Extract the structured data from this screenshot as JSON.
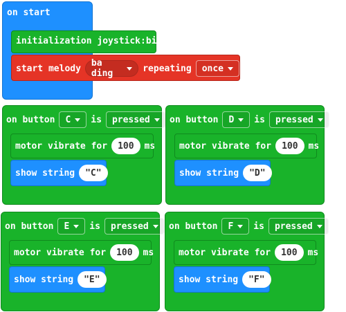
{
  "on_start": {
    "label": "on start",
    "init_label": "initialization joystick:bit",
    "melody": {
      "start_label": "start melody",
      "melody_value": "ba ding",
      "repeating_label": "repeating",
      "repeat_value": "once"
    }
  },
  "common": {
    "on_button_label": "on button",
    "is_label": "is",
    "pressed_label": "pressed",
    "motor_label": "motor vibrate for",
    "ms_label": "ms",
    "show_label": "show string",
    "quote_open": "\"",
    "quote_close": "\""
  },
  "handlers": [
    {
      "button": "C",
      "duration": "100",
      "string": "C"
    },
    {
      "button": "D",
      "duration": "100",
      "string": "D"
    },
    {
      "button": "E",
      "duration": "100",
      "string": "E"
    },
    {
      "button": "F",
      "duration": "100",
      "string": "F"
    }
  ],
  "colors": {
    "basic_blue": "#1e90ff",
    "input_green": "#19b32a",
    "music_red": "#e53426"
  }
}
